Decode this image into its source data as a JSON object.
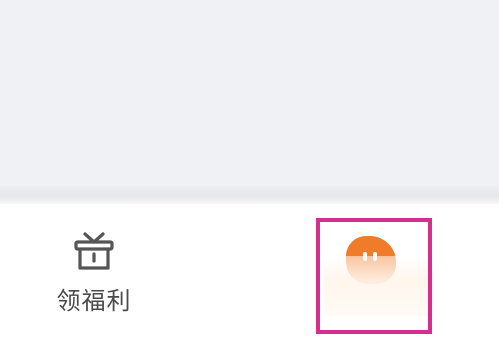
{
  "tab_bar": {
    "welfare": {
      "label": "领福利",
      "icon": "gift-icon",
      "icon_color": "#555555"
    },
    "mine": {
      "icon": "avatar-icon",
      "avatar_color": "#f07c2a",
      "highlight_color": "#d62e8f"
    }
  }
}
